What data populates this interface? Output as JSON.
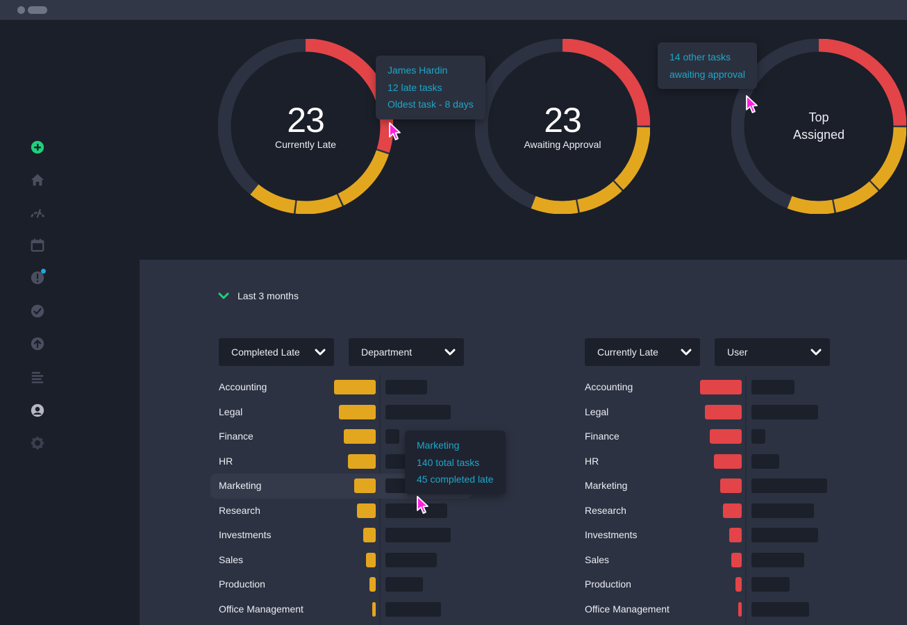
{
  "window": {
    "controls": [
      "window-dot",
      "window-pill"
    ]
  },
  "sidebar": {
    "items": [
      {
        "name": "add",
        "icon": "plus-circle-icon",
        "active": true
      },
      {
        "name": "home",
        "icon": "home-icon"
      },
      {
        "name": "dashboard",
        "icon": "speedometer-icon"
      },
      {
        "name": "calendar",
        "icon": "calendar-icon"
      },
      {
        "name": "alerts",
        "icon": "alert-icon",
        "badge": true
      },
      {
        "name": "completed",
        "icon": "check-circle-icon"
      },
      {
        "name": "upload",
        "icon": "upload-circle-icon"
      },
      {
        "name": "reports",
        "icon": "list-icon"
      },
      {
        "name": "profile",
        "icon": "user-circle-icon"
      },
      {
        "name": "settings",
        "icon": "gear-icon"
      }
    ]
  },
  "colors": {
    "red": "#e34448",
    "amber": "#e3a71f",
    "track": "#2d3242",
    "accent_green": "#1ed07c",
    "tooltip_text": "#1ea7c9",
    "cursor": "#ff1fe0"
  },
  "rings": [
    {
      "number": "23",
      "label": "Currently Late",
      "segments": [
        {
          "color": "red",
          "fraction": 0.3
        },
        {
          "color": "amber",
          "fraction": 0.13
        },
        {
          "color": "amber",
          "fraction": 0.09
        },
        {
          "color": "amber",
          "fraction": 0.09
        }
      ],
      "tooltip": {
        "lines": [
          "James Hardin",
          "12 late tasks",
          "Oldest task - 8 days"
        ]
      }
    },
    {
      "number": "23",
      "label": "Awaiting Approval",
      "segments": [
        {
          "color": "red",
          "fraction": 0.25
        },
        {
          "color": "amber",
          "fraction": 0.13
        },
        {
          "color": "amber",
          "fraction": 0.09
        },
        {
          "color": "amber",
          "fraction": 0.09
        }
      ]
    },
    {
      "number": "",
      "label": "Top Assigned",
      "label_lines": [
        "Top",
        "Assigned"
      ],
      "segments": [
        {
          "color": "red",
          "fraction": 0.25
        },
        {
          "color": "amber",
          "fraction": 0.13
        },
        {
          "color": "amber",
          "fraction": 0.09
        },
        {
          "color": "amber",
          "fraction": 0.09
        }
      ],
      "tooltip": {
        "lines": [
          "14 other tasks",
          "awaiting approval"
        ]
      }
    }
  ],
  "filters": {
    "range_label": "Last 3 months",
    "left": {
      "metric": "Completed Late",
      "group": "Department"
    },
    "right": {
      "metric": "Currently Late",
      "group": "User"
    }
  },
  "chart_data": [
    {
      "type": "bar",
      "title": "Completed Late by Department",
      "categories": [
        "Accounting",
        "Legal",
        "Finance",
        "HR",
        "Marketing",
        "Research",
        "Investments",
        "Sales",
        "Production",
        "Office Management"
      ],
      "series": [
        {
          "name": "Completed Late",
          "color": "amber",
          "values": [
            1.0,
            0.88,
            0.77,
            0.66,
            0.52,
            0.45,
            0.3,
            0.23,
            0.15,
            0.08
          ]
        },
        {
          "name": "Total Tasks",
          "color": "track",
          "values": [
            0.5,
            0.78,
            0.17,
            0.5,
            0.9,
            0.74,
            0.78,
            0.62,
            0.45,
            0.67
          ]
        }
      ],
      "highlighted": "Marketing",
      "tooltip": {
        "lines": [
          "Marketing",
          "140 total tasks",
          "45 completed late"
        ]
      }
    },
    {
      "type": "bar",
      "title": "Currently Late by User",
      "categories": [
        "Accounting",
        "Legal",
        "Finance",
        "HR",
        "Marketing",
        "Research",
        "Investments",
        "Sales",
        "Production",
        "Office Management"
      ],
      "series": [
        {
          "name": "Currently Late",
          "color": "red",
          "values": [
            1.0,
            0.88,
            0.77,
            0.66,
            0.52,
            0.45,
            0.3,
            0.25,
            0.15,
            0.08
          ]
        },
        {
          "name": "Total Tasks",
          "color": "track",
          "values": [
            0.52,
            0.8,
            0.17,
            0.33,
            0.91,
            0.75,
            0.8,
            0.63,
            0.46,
            0.69
          ]
        }
      ]
    }
  ]
}
